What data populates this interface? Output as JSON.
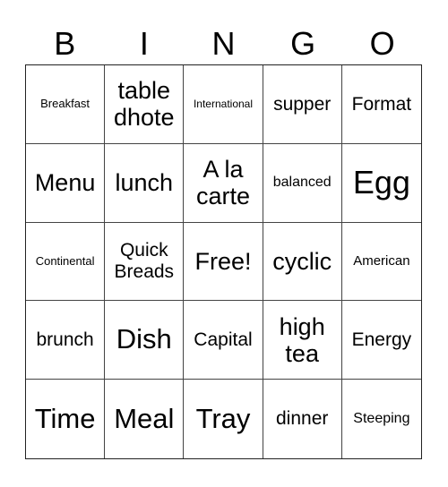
{
  "header": {
    "letters": [
      "B",
      "I",
      "N",
      "G",
      "O"
    ]
  },
  "board": {
    "cells": [
      "Breakfast",
      "table dhote",
      "International",
      "supper",
      "Format",
      "Menu",
      "lunch",
      "A la carte",
      "balanced",
      "Egg",
      "Continental",
      "Quick Breads",
      "Free!",
      "cyclic",
      "American",
      "brunch",
      "Dish",
      "Capital",
      "high tea",
      "Energy",
      "Time",
      "Meal",
      "Tray",
      "dinner",
      "Steeping"
    ]
  }
}
